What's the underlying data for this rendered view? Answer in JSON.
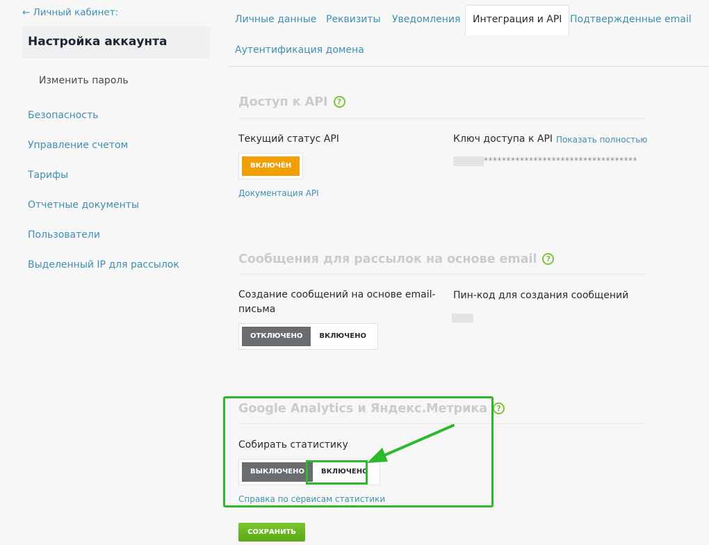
{
  "sidebar": {
    "back_label": "← Личный кабинет:",
    "title": "Настройка аккаунта",
    "sub_item": "Изменить пароль",
    "items": [
      {
        "label": "Безопасность"
      },
      {
        "label": "Управление счетом"
      },
      {
        "label": "Тарифы"
      },
      {
        "label": "Отчетные документы"
      },
      {
        "label": "Пользователи"
      },
      {
        "label": "Выделенный IP для рассылок"
      }
    ]
  },
  "tabs": [
    {
      "label": "Личные данные"
    },
    {
      "label": "Реквизиты"
    },
    {
      "label": "Уведомления"
    },
    {
      "label": "Интеграция и API",
      "active": true
    },
    {
      "label": "Подтвержденные email"
    },
    {
      "label": "Аутентификация домена"
    }
  ],
  "api": {
    "title": "Доступ к API",
    "status_label": "Текущий статус API",
    "status_value": "ВКЛЮЧЁН",
    "docs_link": "Документация API",
    "key_label": "Ключ доступа к API",
    "show_full_link": "Показать полностью",
    "key_masked": "**********************************"
  },
  "email_messages": {
    "title": "Сообщения для рассылок на основе email",
    "create_label": "Создание сообщений на основе email-письма",
    "toggle_off": "ОТКЛЮЧЕНО",
    "toggle_on": "ВКЛЮЧЕНО",
    "pin_label": "Пин-код для создания сообщений"
  },
  "analytics": {
    "title": "Google Analytics и Яндекс.Метрика",
    "collect_label": "Собирать статистику",
    "toggle_off": "ВЫКЛЮЧЕНО",
    "toggle_on": "ВКЛЮЧЕНО",
    "help_link": "Справка по сервисам статистики"
  },
  "save_label": "СОХРАНИТЬ",
  "help_glyph": "?",
  "colors": {
    "link": "#3e8fb0",
    "accent_green": "#5aa817",
    "status_orange": "#f29f05",
    "annotation_green": "#2eb82e"
  }
}
